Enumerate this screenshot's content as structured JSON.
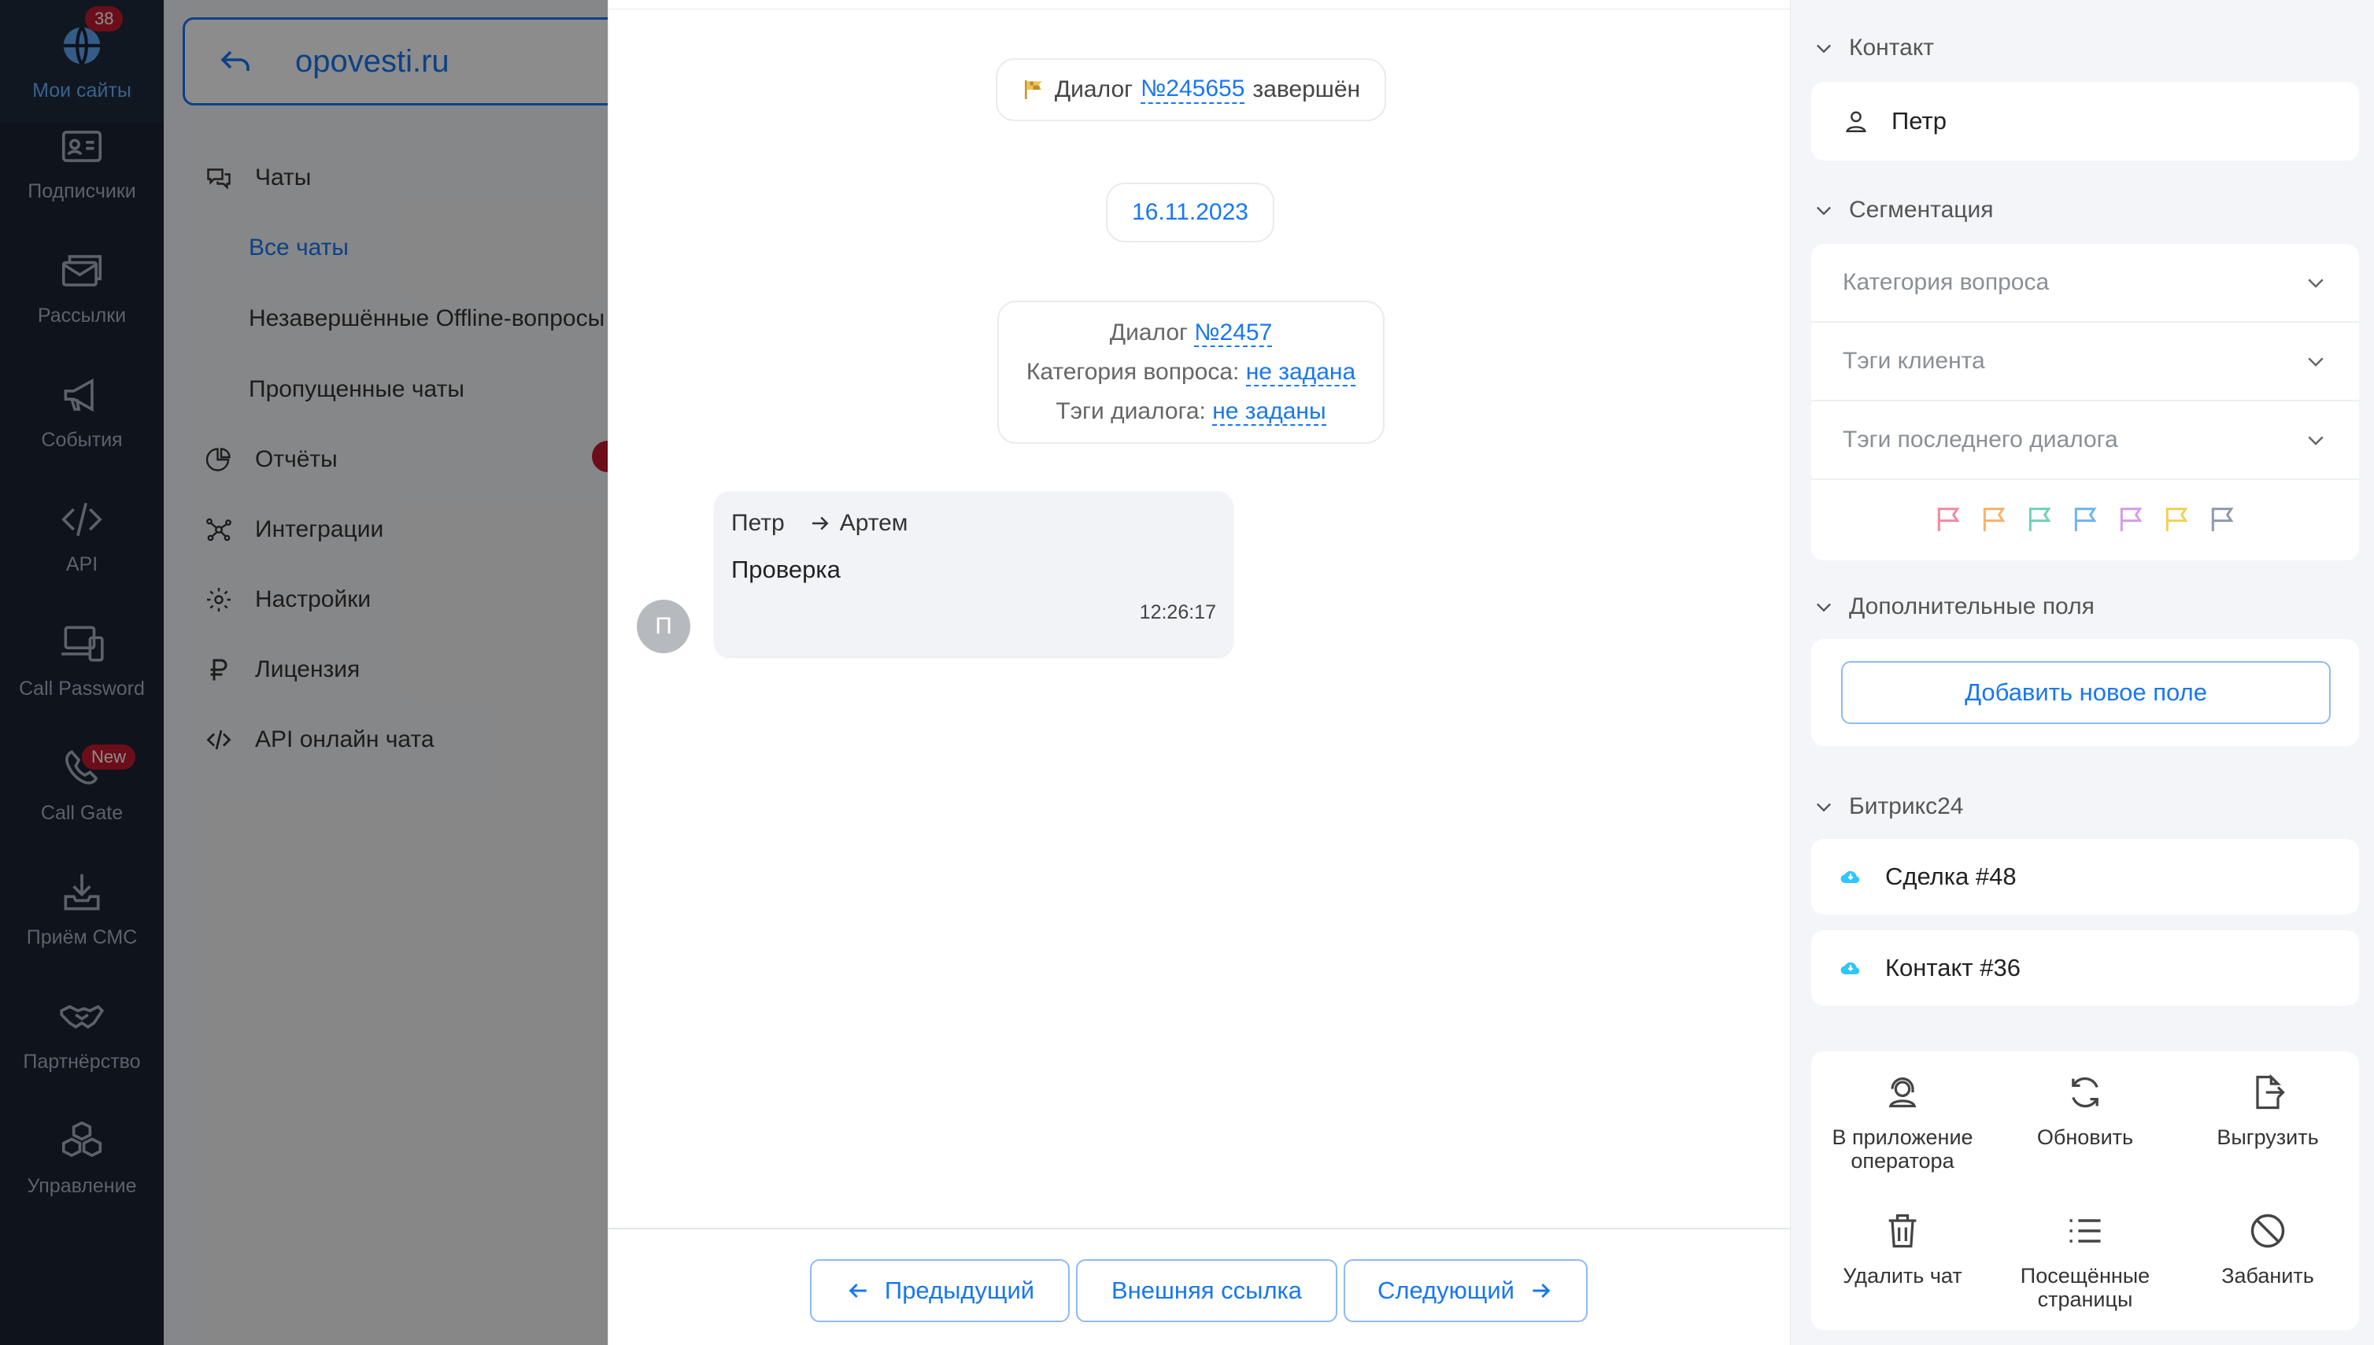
{
  "rail": {
    "items": [
      {
        "label": "Мои сайты",
        "icon": "globe-icon",
        "badge": "38"
      },
      {
        "label": "Подписчики",
        "icon": "contacts-icon"
      },
      {
        "label": "Рассылки",
        "icon": "mail-icon"
      },
      {
        "label": "События",
        "icon": "megaphone-icon"
      },
      {
        "label": "API",
        "icon": "code-icon"
      },
      {
        "label": "Call Password",
        "icon": "devices-icon"
      },
      {
        "label": "Call Gate",
        "icon": "phone-icon",
        "badge": "New"
      },
      {
        "label": "Приём СМС",
        "icon": "inbox-icon"
      },
      {
        "label": "Партнёрство",
        "icon": "handshake-icon"
      },
      {
        "label": "Управление",
        "icon": "cubes-icon"
      }
    ]
  },
  "nav": {
    "site": "opovesti.ru",
    "items": [
      {
        "label": "Чаты",
        "icon": "chats-icon"
      },
      {
        "label": "Все чаты",
        "sub": true,
        "active": true
      },
      {
        "label": "Незавершённые Offline-вопросы",
        "sub": true
      },
      {
        "label": "Пропущенные чаты",
        "sub": true
      },
      {
        "label": "Отчёты",
        "icon": "reports-icon"
      },
      {
        "label": "Интеграции",
        "icon": "integrations-icon"
      },
      {
        "label": "Настройки",
        "icon": "settings-icon"
      },
      {
        "label": "Лицензия",
        "icon": "ruble-icon"
      },
      {
        "label": "API онлайн чата",
        "icon": "code-icon"
      }
    ]
  },
  "chat": {
    "finished": {
      "prefix": "Диалог",
      "number": "№245655",
      "suffix": "завершён"
    },
    "date": "16.11.2023",
    "info": {
      "dialog_label": "Диалог",
      "dialog_number": "№2457",
      "category_label": "Категория вопроса:",
      "category_value": "не задана",
      "tags_label": "Тэги диалога:",
      "tags_value": "не заданы"
    },
    "message": {
      "from": "Петр",
      "to": "Артем",
      "text": "Проверка",
      "time": "12:26:17",
      "avatar": "П"
    },
    "footer": {
      "prev": "Предыдущий",
      "external": "Внешняя ссылка",
      "next": "Следующий"
    }
  },
  "sidebar": {
    "contact": {
      "title": "Контакт",
      "name": "Петр"
    },
    "segmentation": {
      "title": "Сегментация",
      "dropdowns": [
        "Категория вопроса",
        "Тэги клиента",
        "Тэги последнего диалога"
      ],
      "flag_colors": [
        "#f28aa0",
        "#f5b36b",
        "#6dd3b8",
        "#6fb4f0",
        "#d79be6",
        "#f2cf5a",
        "#8e9aab"
      ]
    },
    "extra": {
      "title": "Дополнительные поля",
      "add_button": "Добавить новое поле"
    },
    "bitrix": {
      "title": "Битрикс24",
      "items": [
        "Сделка #48",
        "Контакт #36"
      ]
    },
    "actions": [
      {
        "label": "В приложение оператора",
        "icon": "operator-icon"
      },
      {
        "label": "Обновить",
        "icon": "refresh-icon"
      },
      {
        "label": "Выгрузить",
        "icon": "export-icon"
      },
      {
        "label": "Удалить чат",
        "icon": "trash-icon"
      },
      {
        "label": "Посещённые страницы",
        "icon": "list-icon"
      },
      {
        "label": "Забанить",
        "icon": "ban-icon"
      }
    ]
  }
}
